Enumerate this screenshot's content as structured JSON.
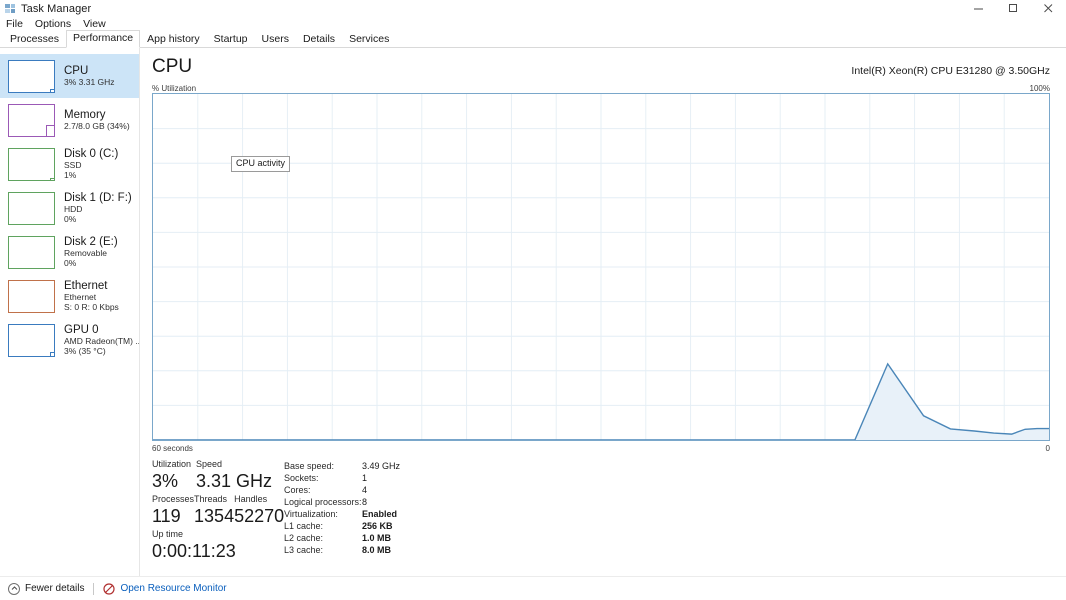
{
  "window": {
    "title": "Task Manager",
    "icon": "task-manager-icon",
    "controls": {
      "minimize": "minimize-icon",
      "maximize": "maximize-icon",
      "close": "close-icon"
    }
  },
  "menu": {
    "items": [
      "File",
      "Options",
      "View"
    ]
  },
  "tabs": {
    "items": [
      "Processes",
      "Performance",
      "App history",
      "Startup",
      "Users",
      "Details",
      "Services"
    ],
    "selected": "Performance"
  },
  "sidebar": {
    "items": [
      {
        "name": "CPU",
        "line2": "3% 3.31 GHz",
        "line3": "",
        "color": "#3a7bbf",
        "selected": true,
        "fill": 9
      },
      {
        "name": "Memory",
        "line2": "2.7/8.0 GB (34%)",
        "line3": "",
        "color": "#9b59b6",
        "selected": false,
        "fill": 34
      },
      {
        "name": "Disk 0 (C:)",
        "line2": "SSD",
        "line3": "1%",
        "color": "#5fa35f",
        "selected": false,
        "fill": 2
      },
      {
        "name": "Disk 1 (D: F:)",
        "line2": "HDD",
        "line3": "0%",
        "color": "#5fa35f",
        "selected": false,
        "fill": 0
      },
      {
        "name": "Disk 2 (E:)",
        "line2": "Removable",
        "line3": "0%",
        "color": "#5fa35f",
        "selected": false,
        "fill": 0
      },
      {
        "name": "Ethernet",
        "line2": "Ethernet",
        "line3": "S: 0 R: 0 Kbps",
        "color": "#c0714a",
        "selected": false,
        "fill": 0
      },
      {
        "name": "GPU 0",
        "line2": "AMD Radeon(TM) ...",
        "line3": "3% (35 °C)",
        "color": "#3a7bbf",
        "selected": false,
        "fill": 12
      }
    ]
  },
  "main": {
    "title": "CPU",
    "cpu_name": "Intel(R) Xeon(R) CPU E31280 @ 3.50GHz",
    "graph_axis_label": "% Utilization",
    "graph_max_label": "100%",
    "graph_time_label": "60 seconds",
    "graph_min_label": "0",
    "tooltip": "CPU activity"
  },
  "chart_data": {
    "type": "area",
    "title": "% Utilization",
    "xlabel": "60 seconds",
    "ylabel": "% Utilization",
    "ylim": [
      0,
      100
    ],
    "xlim": [
      0,
      60
    ],
    "grid": true,
    "grid_cols": 20,
    "grid_rows": 10,
    "line_color": "#4a86b8",
    "fill_color": "#e8f1f9",
    "series": [
      {
        "name": "CPU utilization",
        "x": [
          0,
          46,
          47,
          49.2,
          51.6,
          53.4,
          55.0,
          56.3,
          57.5,
          58.4,
          59.2,
          60
        ],
        "values": [
          0,
          0,
          0,
          22,
          7,
          3.2,
          2.6,
          2.0,
          1.7,
          3.1,
          3.3,
          3.3
        ]
      }
    ]
  },
  "stats": {
    "left": [
      {
        "label": "Utilization",
        "value": "3%"
      },
      {
        "label": "Speed",
        "value": "3.31 GHz"
      },
      {
        "label": "Processes",
        "value": "119"
      },
      {
        "label": "Threads",
        "value": "1354"
      },
      {
        "label": "Handles",
        "value": "52270"
      },
      {
        "label": "Up time",
        "value": "0:00:11:23"
      }
    ],
    "specs": [
      {
        "key": "Base speed:",
        "value": "3.49 GHz",
        "bold": false
      },
      {
        "key": "Sockets:",
        "value": "1",
        "bold": false
      },
      {
        "key": "Cores:",
        "value": "4",
        "bold": false
      },
      {
        "key": "Logical processors:",
        "value": "8",
        "bold": false
      },
      {
        "key": "Virtualization:",
        "value": "Enabled",
        "bold": true
      },
      {
        "key": "L1 cache:",
        "value": "256 KB",
        "bold": true
      },
      {
        "key": "L2 cache:",
        "value": "1.0 MB",
        "bold": true
      },
      {
        "key": "L3 cache:",
        "value": "8.0 MB",
        "bold": true
      }
    ]
  },
  "statusbar": {
    "fewer_details": "Fewer details",
    "open_resource_monitor": "Open Resource Monitor"
  }
}
